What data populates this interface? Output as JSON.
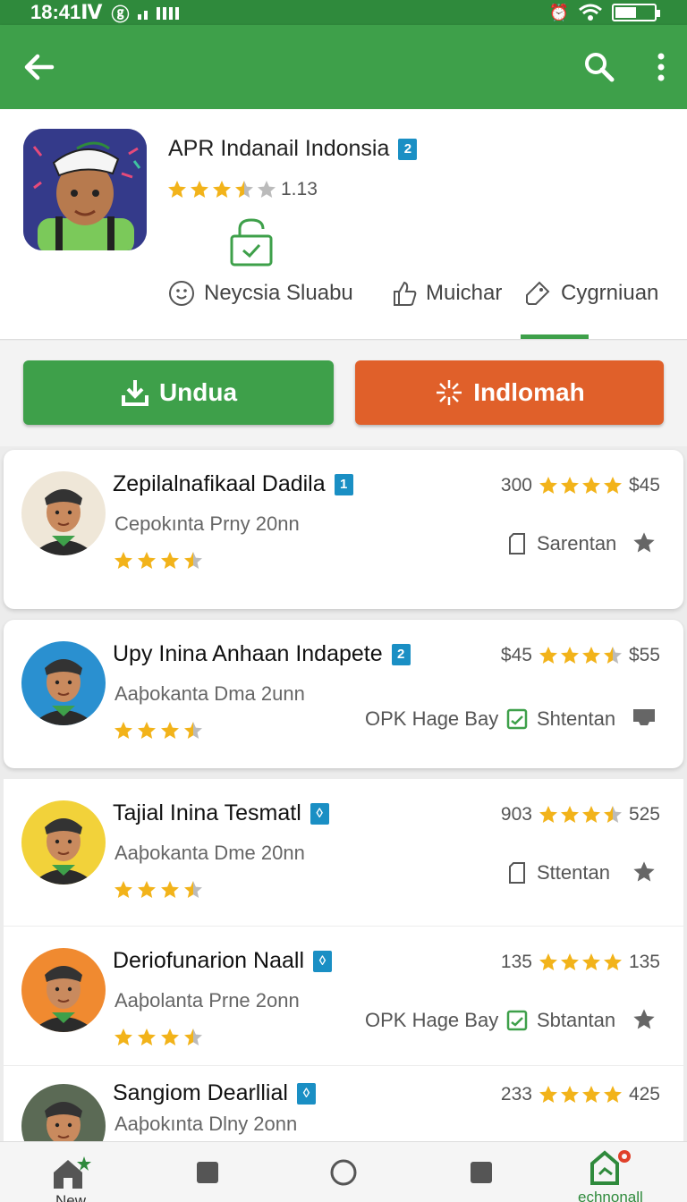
{
  "status_bar": {
    "time": "18:41Ⅳ",
    "battery_level": 0.55
  },
  "app_bar": {
    "back_icon": "arrow-left-icon",
    "search_icon": "search-icon",
    "menu_icon": "more-vert-icon"
  },
  "app": {
    "title": "APR Indanail Indonsia",
    "badge": "2",
    "rating": 3.5,
    "rating_text": "1.13"
  },
  "tabs": [
    {
      "label": "Neycsia Sluabu",
      "icon": "face-icon"
    },
    {
      "label": "Muichar",
      "icon": "thumb-up-icon"
    },
    {
      "label": "Cygrniuan",
      "icon": "tag-icon",
      "selected": true
    }
  ],
  "buttons": {
    "download": "Unduа",
    "other": "Indlomah"
  },
  "items": [
    {
      "name": "Zepilalnafikaal Dadila",
      "badge": "1",
      "sub": "Cepokınta Prny 20nn",
      "stars": 3.5,
      "meta_left": "300",
      "meta_stars": 4,
      "meta_right": "$45",
      "action": "Sarentan",
      "extra": "",
      "avatar_bg": "#efe7d8"
    },
    {
      "name": "Upy Inina Anhaan Indapete",
      "badge": "2",
      "sub": "Aaþokanta Dma 2unn",
      "stars": 3.5,
      "meta_left": "$45",
      "meta_stars": 3.5,
      "meta_right": "$55",
      "action": "Shtentan",
      "extra": "OPK Hage Bay",
      "avatar_bg": "#2a90d0"
    },
    {
      "name": "Tajial Inina Tesmatl",
      "badge": "◊",
      "sub": "Aaþokanta Dme 20nn",
      "stars": 3.5,
      "meta_left": "903",
      "meta_stars": 3.5,
      "meta_right": "525",
      "action": "Sttentan",
      "extra": "",
      "avatar_bg": "#f2d23a"
    },
    {
      "name": "Deriofunarion Naall",
      "badge": "◊",
      "sub": "Aaþolanta Prne 2onn",
      "stars": 3.5,
      "meta_left": "135",
      "meta_stars": 4,
      "meta_right": "135",
      "action": "Sbtantan",
      "extra": "OPK Hage Bay",
      "avatar_bg": "#f08a30"
    },
    {
      "name": "Sangiom Dearllial",
      "badge": "◊",
      "sub": "Aaþokınta Dlny 2onn",
      "stars": 0,
      "meta_left": "233",
      "meta_stars": 4,
      "meta_right": "425",
      "action": "",
      "extra": "",
      "avatar_bg": "#5b6a55"
    }
  ],
  "bottom_nav": [
    {
      "label": "New",
      "icon": "home-icon"
    },
    {
      "label": "",
      "icon": "square-icon"
    },
    {
      "label": "",
      "icon": "circle-icon"
    },
    {
      "label": "",
      "icon": "square-icon"
    },
    {
      "label": "echnonall",
      "icon": "store-icon"
    }
  ],
  "colors": {
    "green": "#3ea04a",
    "orange": "#e0602a",
    "star": "#f2b31a",
    "badge": "#1a8fc4"
  }
}
